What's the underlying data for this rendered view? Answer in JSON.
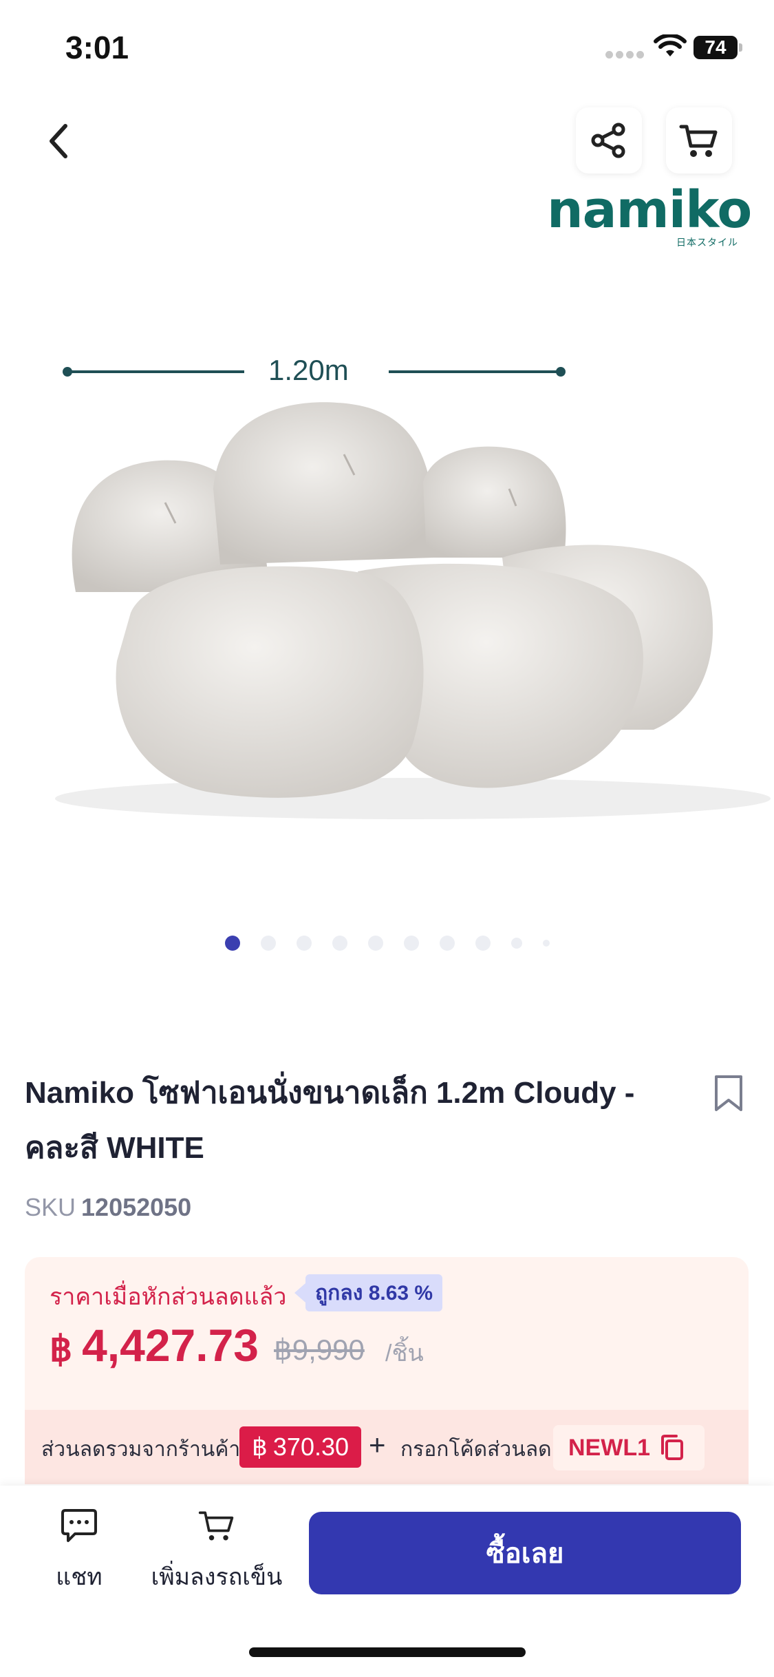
{
  "status": {
    "time": "3:01",
    "battery": "74"
  },
  "nav": {
    "back_icon": "chevron-left-icon",
    "share_icon": "share-icon",
    "cart_icon": "cart-icon"
  },
  "brand": {
    "name": "namiko",
    "subtitle": "日本スタイル"
  },
  "image": {
    "dimension_label": "1.20m"
  },
  "carousel": {
    "count": 10,
    "active_index": 0
  },
  "product": {
    "title": "Namiko โซฟาเอนนั่งขนาดเล็ก 1.2m Cloudy  - คละสี WHITE",
    "sku_label": "SKU",
    "sku_value": "12052050"
  },
  "price": {
    "label": "ราคาเมื่อหักส่วนลดแล้ว",
    "discount_tag": "ถูกลง 8.63 %",
    "currency": "฿",
    "current": "4,427.73",
    "original": "฿9,990",
    "unit": "/ชิ้น"
  },
  "promo": {
    "text": "ส่วนลดรวมจากร้านค้า",
    "amount_currency": "฿",
    "amount": "370.30",
    "plus": "+",
    "code_label": "กรอกโค้ดส่วนลด",
    "code": "NEWL1"
  },
  "bottom": {
    "chat_label": "แชท",
    "add_cart_label": "เพิ่มลงรถเข็น",
    "buy_label": "ซื้อเลย"
  },
  "colors": {
    "accent": "#3338b0",
    "price_red": "#d3224a",
    "brand_teal": "#106b64"
  }
}
